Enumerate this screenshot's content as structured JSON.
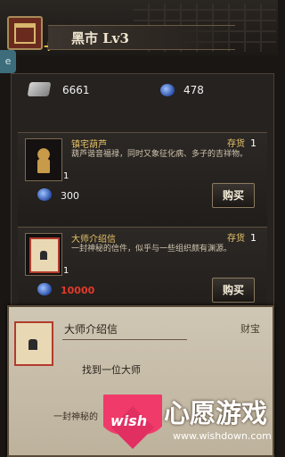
{
  "header": {
    "title": "黑市  Lv3"
  },
  "side_tab": {
    "label": "e"
  },
  "currency": {
    "silver": "6661",
    "gems": "478"
  },
  "items": [
    {
      "name": "镇宅葫芦",
      "stock_label": "存货",
      "stock": "1",
      "qty": "1",
      "desc": "葫芦谐音福禄，同时又象征化病、多子的吉祥物。",
      "price": "300",
      "buy_label": "购买"
    },
    {
      "name": "大师介绍信",
      "stock_label": "存货",
      "stock": "1",
      "qty": "1",
      "desc": "一封神秘的信件，似乎与一些组织颇有渊源。",
      "price": "10000",
      "buy_label": "购买"
    }
  ],
  "popup": {
    "name": "大师介绍信",
    "type": "财宝",
    "effect": "找到一位大师",
    "desc": "一封神秘的"
  },
  "watermark": {
    "wish": "wish",
    "brand": "心愿游戏",
    "url": "www.wishdown.com"
  }
}
